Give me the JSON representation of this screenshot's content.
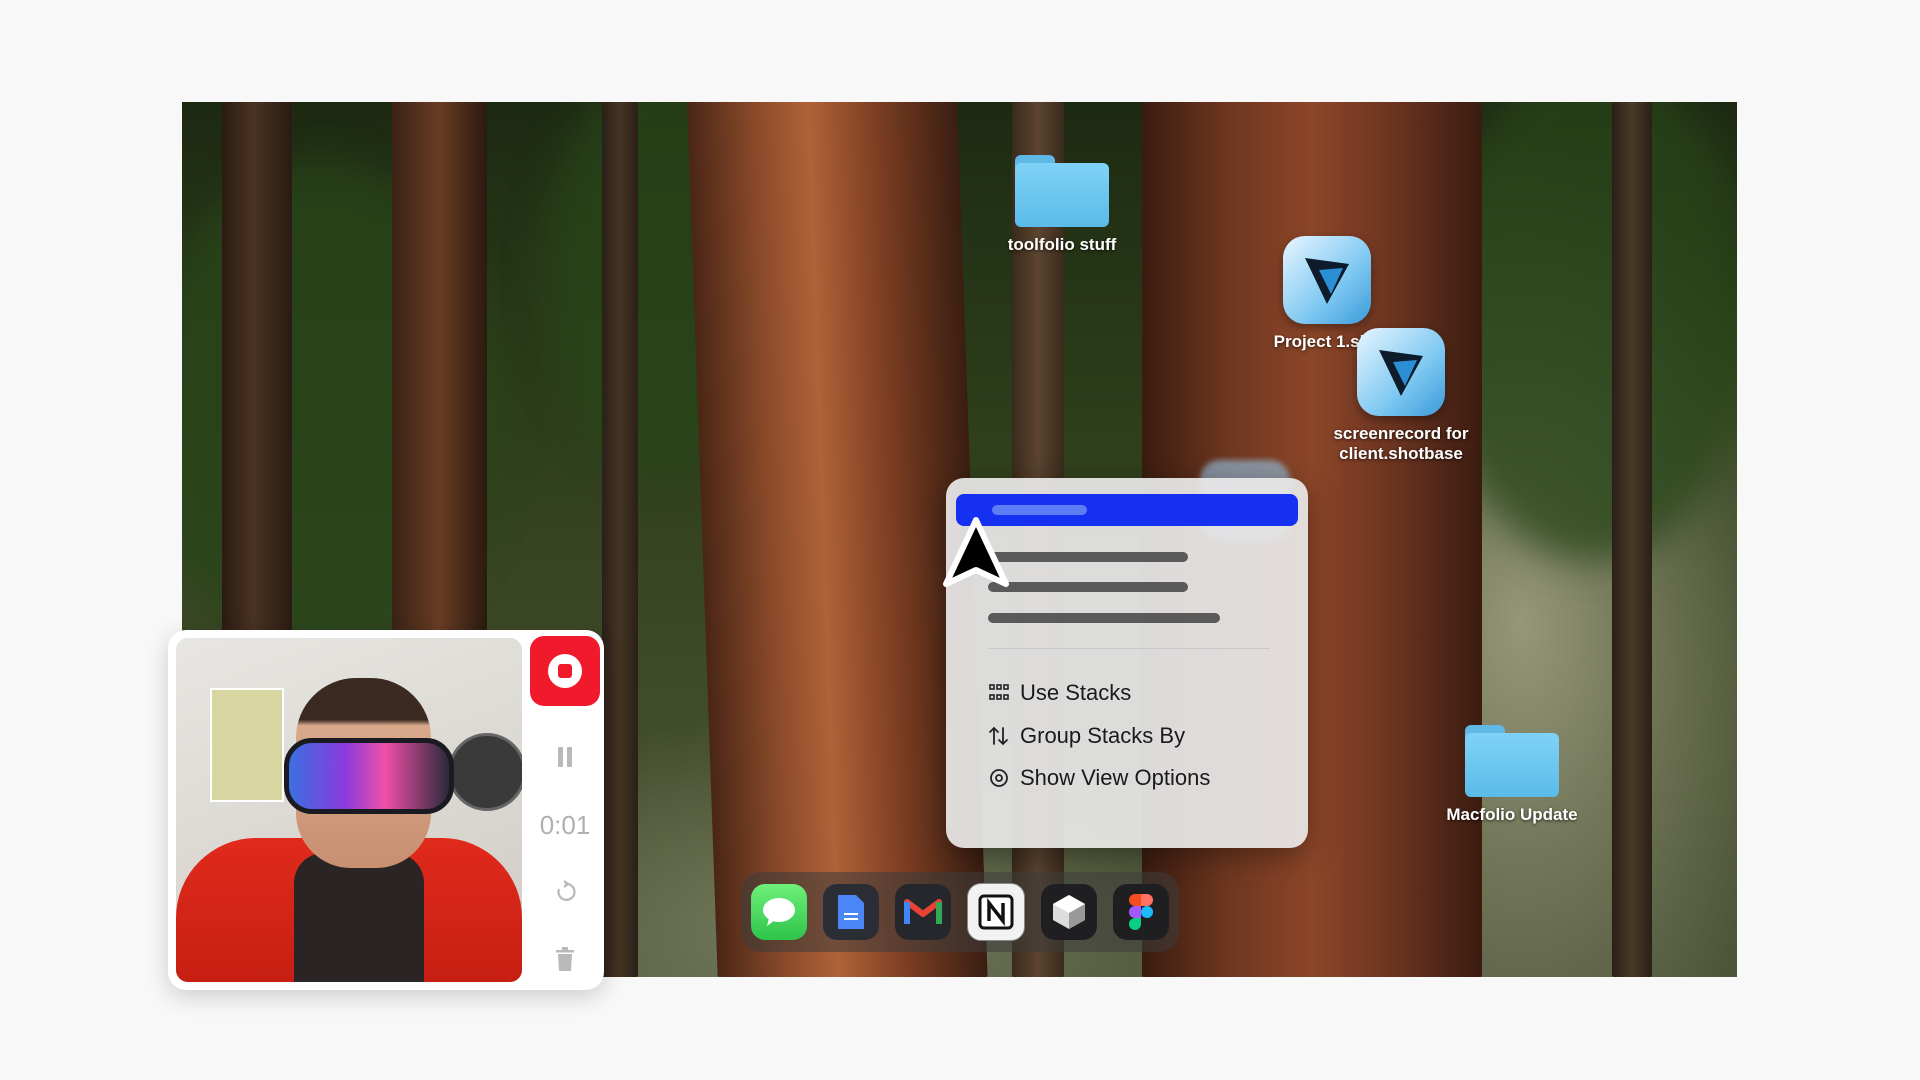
{
  "desktop": {
    "icons": [
      {
        "label": "toolfolio stuff",
        "kind": "folder-icon"
      },
      {
        "label": "Project 1.sho",
        "kind": "shotbase-app-icon"
      },
      {
        "label": "screenrecord for client.shotbase",
        "kind": "shotbase-app-icon"
      },
      {
        "label": "Macfolio Update",
        "kind": "folder-icon"
      }
    ]
  },
  "context_menu": {
    "items": [
      {
        "label": "Use Stacks",
        "icon": "grid-icon"
      },
      {
        "label": "Group Stacks By",
        "icon": "sort-arrows-icon"
      },
      {
        "label": "Show View Options",
        "icon": "gear-icon"
      }
    ],
    "highlight_color": "#1530f0"
  },
  "dock": {
    "apps": [
      {
        "name": "Messages",
        "icon": "messages-icon"
      },
      {
        "name": "Google Docs",
        "icon": "docs-icon"
      },
      {
        "name": "Gmail",
        "icon": "gmail-icon",
        "glyph": "M"
      },
      {
        "name": "Notion",
        "icon": "notion-icon",
        "glyph": "N"
      },
      {
        "name": "Box app",
        "icon": "cube-icon"
      },
      {
        "name": "Figma",
        "icon": "figma-icon"
      }
    ]
  },
  "recorder": {
    "timer": "0:01",
    "record_color": "#f01a2c"
  }
}
